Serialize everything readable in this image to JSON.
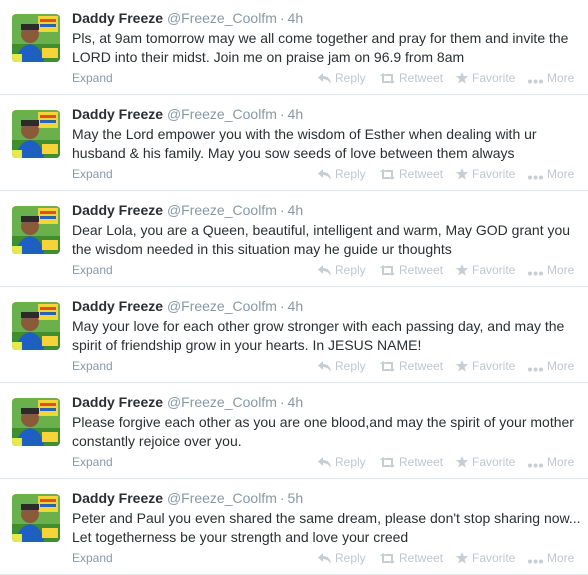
{
  "tweets": [
    {
      "name": "Daddy Freeze",
      "handle": "@Freeze_Coolfm",
      "time": "4h",
      "text": "Pls, at 9am tomorrow may we all come together and pray for them and invite the LORD into their midst. Join me on praise jam on 96.9 from 8am",
      "expand": "Expand"
    },
    {
      "name": "Daddy Freeze",
      "handle": "@Freeze_Coolfm",
      "time": "4h",
      "text": "May the Lord empower you with the wisdom of Esther when dealing with ur husband & his family. May you sow seeds of love between them always",
      "expand": "Expand"
    },
    {
      "name": "Daddy Freeze",
      "handle": "@Freeze_Coolfm",
      "time": "4h",
      "text": "Dear Lola, you are a Queen, beautiful, intelligent and warm, May GOD grant you the wisdom needed in this situation may he guide ur thoughts",
      "expand": "Expand"
    },
    {
      "name": "Daddy Freeze",
      "handle": "@Freeze_Coolfm",
      "time": "4h",
      "text": "May your love for each other grow stronger with each passing day, and may the spirit of friendship grow in your hearts. In JESUS NAME!",
      "expand": "Expand"
    },
    {
      "name": "Daddy Freeze",
      "handle": "@Freeze_Coolfm",
      "time": "4h",
      "text": "Please forgive each other as you are one blood,and may the spirit of your mother constantly rejoice over you.",
      "expand": "Expand"
    },
    {
      "name": "Daddy Freeze",
      "handle": "@Freeze_Coolfm",
      "time": "5h",
      "text": "Peter and Paul you even shared the same dream, please don't stop sharing now... Let togetherness be your strength and love your creed",
      "expand": "Expand"
    }
  ],
  "actions": {
    "reply": "Reply",
    "retweet": "Retweet",
    "favorite": "Favorite",
    "more": "More"
  },
  "icons": {
    "reply": "reply-arrow-icon",
    "retweet": "retweet-icon",
    "favorite": "star-icon",
    "more": "ellipsis-icon"
  },
  "colors": {
    "name": "#292f33",
    "meta": "#8899a6",
    "action": "#bfc7ce",
    "avatar_green": "#4caf50",
    "avatar_yellow": "#f5d33a"
  }
}
